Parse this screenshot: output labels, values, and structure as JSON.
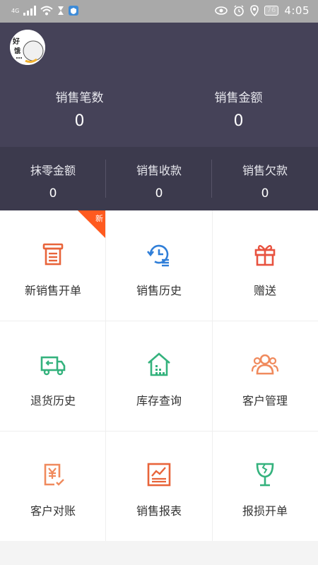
{
  "status_bar": {
    "network": "4G",
    "battery": "76",
    "time": "4:05"
  },
  "header": {
    "avatar_text": "好饿",
    "stats": [
      {
        "label": "销售笔数",
        "value": "0"
      },
      {
        "label": "销售金额",
        "value": "0"
      }
    ]
  },
  "subheader": [
    {
      "label": "抹零金额",
      "value": "0"
    },
    {
      "label": "销售收款",
      "value": "0"
    },
    {
      "label": "销售欠款",
      "value": "0"
    }
  ],
  "grid": {
    "badge": "新",
    "items": [
      {
        "label": "新销售开单",
        "icon": "register-icon",
        "color": "#e8643a"
      },
      {
        "label": "销售历史",
        "icon": "history-icon",
        "color": "#2f7ed8"
      },
      {
        "label": "赠送",
        "icon": "gift-icon",
        "color": "#e8523f"
      },
      {
        "label": "退货历史",
        "icon": "truck-return-icon",
        "color": "#34b27d"
      },
      {
        "label": "库存查询",
        "icon": "warehouse-icon",
        "color": "#34b27d"
      },
      {
        "label": "客户管理",
        "icon": "users-icon",
        "color": "#f08a5d"
      },
      {
        "label": "客户对账",
        "icon": "yen-bill-icon",
        "color": "#f08a5d"
      },
      {
        "label": "销售报表",
        "icon": "chart-icon",
        "color": "#e8643a"
      },
      {
        "label": "报损开单",
        "icon": "broken-glass-icon",
        "color": "#34b27d"
      }
    ]
  }
}
